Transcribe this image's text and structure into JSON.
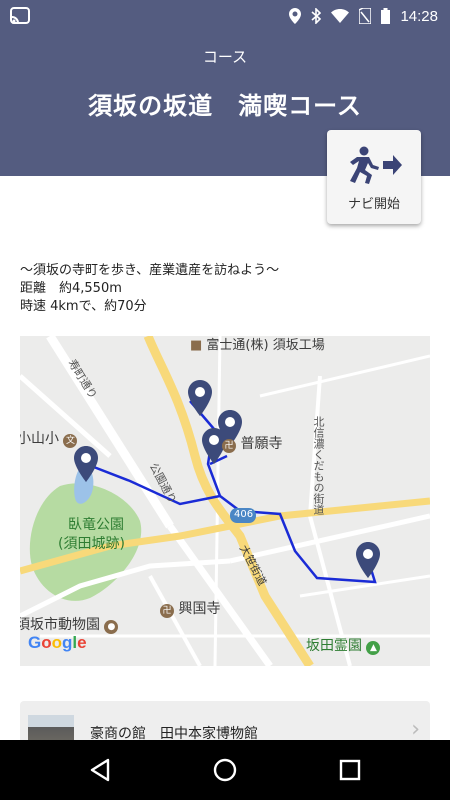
{
  "status_bar": {
    "time": "14:28"
  },
  "header": {
    "subtitle": "コース",
    "title": "須坂の坂道　満喫コース"
  },
  "navi_button": {
    "label": "ナビ開始"
  },
  "description": {
    "line1": "～須坂の寺町を歩き、産業遺産を訪ねよう～",
    "line2": "距離　約4,550m",
    "line3": "時速 4kmで、約70分"
  },
  "map": {
    "labels": {
      "fuji": "富士通(株) 須坂工場",
      "suzakamachi": "寿町通り",
      "school": "小山小",
      "fuganji": "普願寺",
      "kitashinano": "北信濃くだもの街道",
      "koendori": "公園通り",
      "route406": "406",
      "park1": "臥竜公園",
      "park2": "(須田城跡)",
      "oyanagi": "大笹街道",
      "kokokuji": "興国寺",
      "zoo": "須坂市動物園",
      "cemetery": "坂田霊園",
      "google": "Google"
    },
    "colors": {
      "route": "#1a2bd6",
      "pin": "#3c4a7a",
      "park": "#b6dba2"
    }
  },
  "poi_card": {
    "title": "豪商の館　田中本家博物館"
  },
  "colors": {
    "header_bg": "#545c80"
  }
}
